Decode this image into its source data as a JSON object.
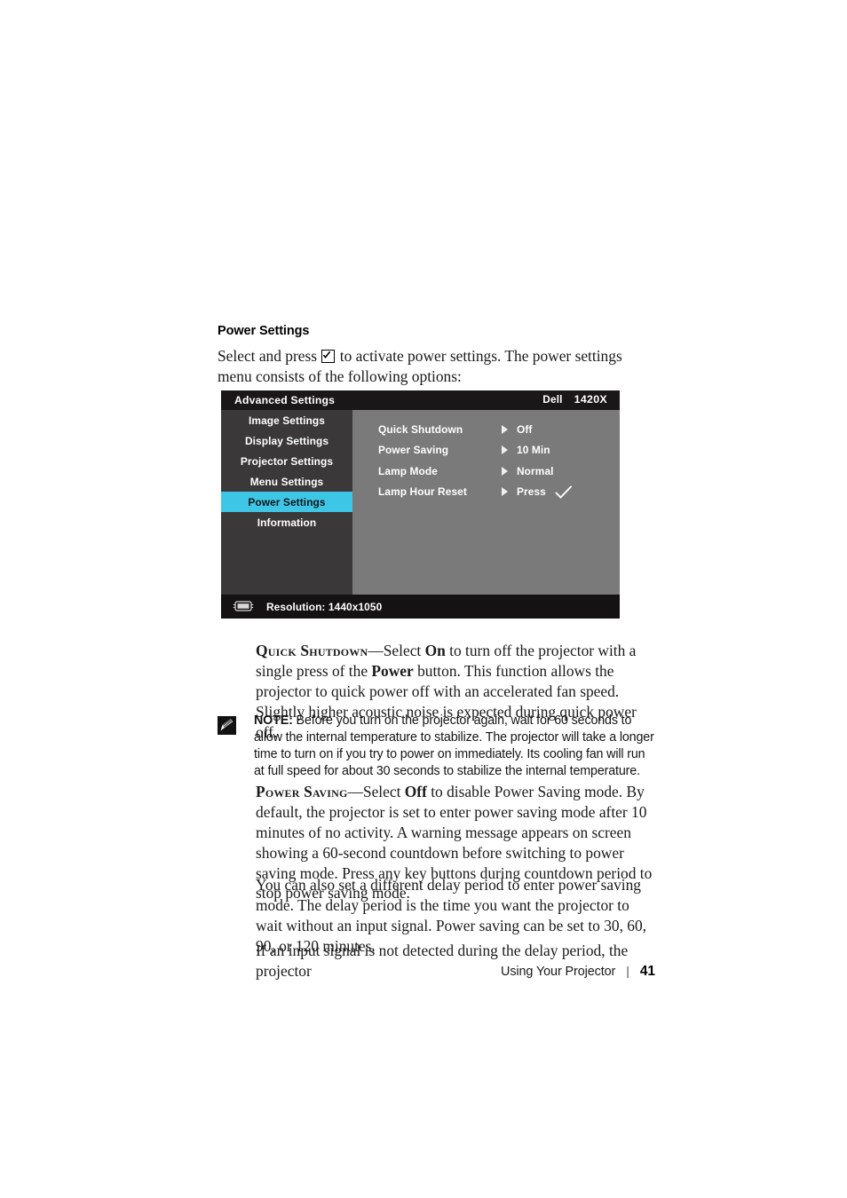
{
  "section": {
    "heading": "Power Settings",
    "intro_before": "Select and press",
    "intro_icon": "enter-checkmark-key-icon",
    "intro_after": "to activate power settings. The power settings menu consists of the following options:"
  },
  "osd": {
    "title": "Advanced Settings",
    "brand": "Dell",
    "model": "1420X",
    "highlight_color": "#3ec6e6",
    "panel_color": "#7a7a7a",
    "sidebar_color": "#3a3838",
    "titlebar_color": "#1a1718",
    "sidebar": [
      {
        "label": "Image Settings",
        "selected": false
      },
      {
        "label": "Display Settings",
        "selected": false
      },
      {
        "label": "Projector Settings",
        "selected": false
      },
      {
        "label": "Menu Settings",
        "selected": false
      },
      {
        "label": "Power Settings",
        "selected": true
      },
      {
        "label": "Information",
        "selected": false
      }
    ],
    "rows": [
      {
        "label": "Quick Shutdown",
        "value": "Off",
        "check": false
      },
      {
        "label": "Power Saving",
        "value": "10 Min",
        "check": false
      },
      {
        "label": "Lamp Mode",
        "value": "Normal",
        "check": false
      },
      {
        "label": "Lamp Hour Reset",
        "value": "Press",
        "check": true
      }
    ],
    "footer": {
      "icon": "display-resolution-icon",
      "text": "Resolution: 1440x1050"
    }
  },
  "quick_shutdown": {
    "term": "Quick Shutdown",
    "dash": "—",
    "text_1": "Select ",
    "bold_1": "On",
    "text_2": " to turn off the projector with a single press of the ",
    "bold_2": "Power",
    "text_3": " button. This function allows the projector to quick power off with an accelerated fan speed. Slightly higher acoustic noise is expected during quick power off."
  },
  "note": {
    "icon": "note-pencil-icon",
    "label": "NOTE:",
    "text": " Before you turn on the projector again, wait for 60 seconds to allow the internal temperature to stabilize. The projector will take a longer time to turn on if you try to power on immediately. Its cooling fan will run at full speed for about 30 seconds to stabilize the internal temperature."
  },
  "power_saving": {
    "term": "Power Saving",
    "dash": "—",
    "text_1": "Select ",
    "bold_1": "Off",
    "text_2": " to disable Power Saving mode. By default, the projector is set to enter power saving mode after 10 minutes of no activity. A warning message appears on screen showing a 60-second countdown before switching to power saving mode. Press any key buttons during countdown period to stop power saving mode."
  },
  "paragraph_delay": "You can also set a different delay period to enter power saving mode. The delay period is the time you want the projector to wait without an input signal. Power saving can be set to 30, 60, 90, or 120 minutes.",
  "paragraph_nosignal": "If an input signal is not detected during the delay period, the projector",
  "page_footer": {
    "chapter": "Using Your Projector",
    "separator": "|",
    "page_number": "41"
  }
}
